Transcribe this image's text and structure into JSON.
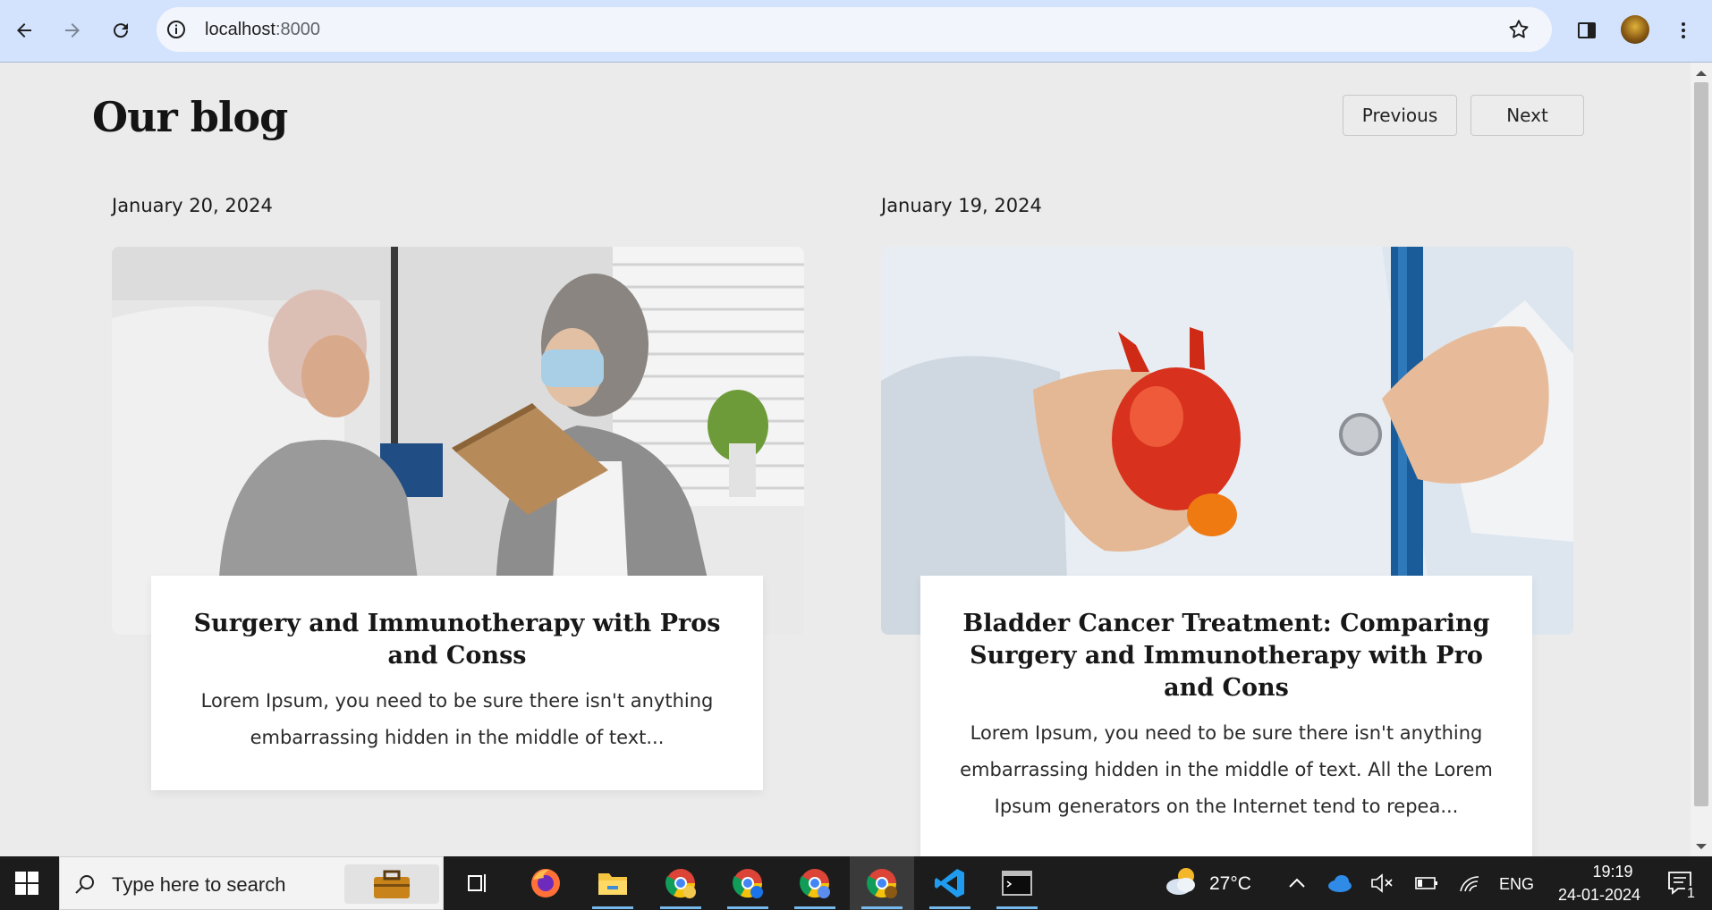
{
  "browser": {
    "url_host": "localhost",
    "url_port": ":8000"
  },
  "page": {
    "title": "Our blog",
    "pager": {
      "previous": "Previous",
      "next": "Next"
    },
    "posts": [
      {
        "date": "January 20, 2024",
        "image_alt": "Patient and visitor reading a book in hospital room",
        "title": "Surgery and Immunotherapy with Pros and Conss",
        "excerpt": "Lorem Ipsum, you need to be sure there isn't anything embarrassing hidden in the middle of text..."
      },
      {
        "date": "January 19, 2024",
        "image_alt": "Doctor holding a bladder model and stethoscope",
        "title": "Bladder Cancer Treatment: Comparing Surgery and Immunotherapy with Pro and Cons",
        "excerpt": "Lorem Ipsum, you need to be sure there isn't anything embarrassing hidden in the middle of text. All the Lorem Ipsum generators on the Internet tend to repea..."
      }
    ]
  },
  "taskbar": {
    "search_placeholder": "Type here to search",
    "weather": "27°C",
    "language": "ENG",
    "time": "19:19",
    "date": "24-01-2024",
    "notification_count": "1"
  }
}
